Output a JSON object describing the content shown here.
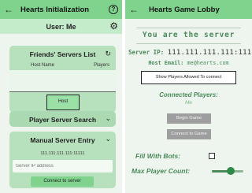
{
  "left": {
    "title": "Hearts Initialization",
    "help_glyph": "?",
    "user_label": "User: Me",
    "friends_card": {
      "title": "Friends' Servers List",
      "col_host": "Host Name",
      "col_players": "Players",
      "host_button": "Host"
    },
    "search_card": {
      "title": "Player Server Search"
    },
    "manual_card": {
      "title": "Manual Server Entry",
      "ip_label": "111.111.111.111:11111",
      "ip_placeholder": "Server IP address",
      "connect_button": "Connect to server"
    }
  },
  "right": {
    "title": "Hearts Game Lobby",
    "heading": "You are the server",
    "ip_label": "Server IP:",
    "ip_value": "111.111.111.111:11111",
    "email_label": "Host Email:",
    "email_value": "me@hearts.com",
    "show_players_button": "Show Players Allowed To connect",
    "connected_title": "Connected Players:",
    "connected_players": [
      "Me"
    ],
    "begin_button": "Begin Game",
    "connect_game_button": "Connect to Game",
    "fill_bots_label": "Fill With Bots:",
    "fill_bots_checked": false,
    "max_count_label": "Max Player Count:",
    "max_count_level": 0.6
  },
  "icons": {
    "back": "arrow-left-icon",
    "help": "help-circle-icon",
    "gear": "gear-icon",
    "refresh": "refresh-icon",
    "chevron": "chevron-down-icon"
  },
  "colors": {
    "appbar": "#7fd38d",
    "card": "#b7e0bc",
    "accent_text": "#4a8a5a",
    "disabled_button": "#9e9e9e"
  }
}
